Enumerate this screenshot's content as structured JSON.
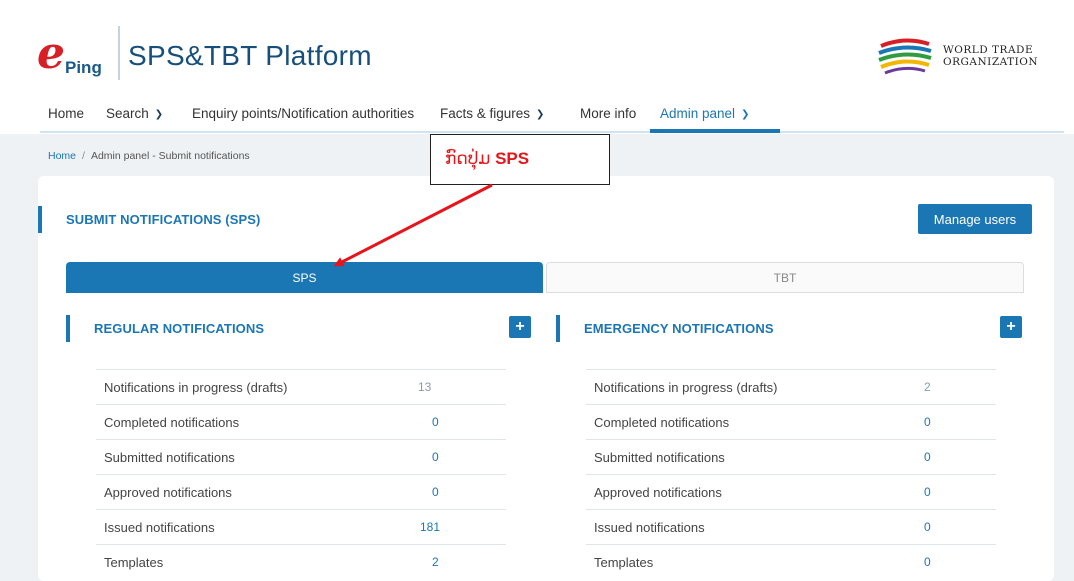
{
  "header": {
    "logo_e": "e",
    "logo_ping": "Ping",
    "platform_title": "SPS&TBT Platform",
    "wto_line1": "WORLD TRADE",
    "wto_line2": "ORGANIZATION"
  },
  "nav": {
    "items": [
      {
        "label": "Home",
        "dropdown": false
      },
      {
        "label": "Search",
        "dropdown": true
      },
      {
        "label": "Enquiry points/Notification authorities",
        "dropdown": false
      },
      {
        "label": "Facts & figures",
        "dropdown": true
      },
      {
        "label": "More info",
        "dropdown": false
      },
      {
        "label": "Admin panel",
        "dropdown": true,
        "active": true
      }
    ]
  },
  "breadcrumb": {
    "home": "Home",
    "separator": "/",
    "current": "Admin panel - Submit notifications"
  },
  "page": {
    "title": "SUBMIT NOTIFICATIONS (SPS)",
    "manage_users": "Manage users"
  },
  "tabs": [
    {
      "label": "SPS",
      "active": true
    },
    {
      "label": "TBT",
      "active": false
    }
  ],
  "regular": {
    "title": "REGULAR NOTIFICATIONS",
    "rows": [
      {
        "label": "Notifications in progress (drafts)",
        "value": "13"
      },
      {
        "label": "Completed notifications",
        "value": "0"
      },
      {
        "label": "Submitted notifications",
        "value": "0"
      },
      {
        "label": "Approved notifications",
        "value": "0"
      },
      {
        "label": "Issued notifications",
        "value": "181"
      },
      {
        "label": "Templates",
        "value": "2"
      }
    ]
  },
  "emergency": {
    "title": "EMERGENCY NOTIFICATIONS",
    "rows": [
      {
        "label": "Notifications in progress (drafts)",
        "value": "2"
      },
      {
        "label": "Completed notifications",
        "value": "0"
      },
      {
        "label": "Submitted notifications",
        "value": "0"
      },
      {
        "label": "Approved notifications",
        "value": "0"
      },
      {
        "label": "Issued notifications",
        "value": "0"
      },
      {
        "label": "Templates",
        "value": "0"
      }
    ]
  },
  "annotation": {
    "text_lao": "ກົດປຸ່ມ ",
    "text_bold": "SPS"
  },
  "icons": {
    "plus": "+",
    "chevron": "❯"
  },
  "colors": {
    "accent": "#1b76b4",
    "annotation_red": "#e8141b"
  }
}
